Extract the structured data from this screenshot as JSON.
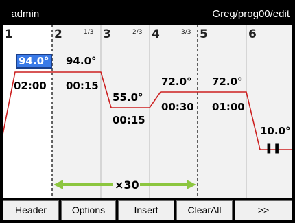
{
  "titlebar": {
    "user": "_admin",
    "path": "Greg/prog00/edit"
  },
  "steps": [
    {
      "num": "1",
      "temp": "94.0°",
      "time": "02:00"
    },
    {
      "num": "2",
      "sub": "1/3",
      "temp": "94.0°",
      "time": "00:15"
    },
    {
      "num": "3",
      "sub": "2/3",
      "temp": "55.0°",
      "time": "00:15"
    },
    {
      "num": "4",
      "sub": "3/3",
      "temp": "72.0°",
      "time": "00:30"
    },
    {
      "num": "5",
      "temp": "72.0°",
      "time": "01:00"
    },
    {
      "num": "6",
      "temp": "10.0°",
      "time": "❚❚"
    }
  ],
  "loop": {
    "label": "×30"
  },
  "buttons": [
    "Header",
    "Options",
    "Insert",
    "ClearAll",
    ">>"
  ],
  "colors": {
    "profile_line": "#cc1f1f",
    "loop_arrow": "#8cc63f",
    "selected": "#3a7ae8"
  }
}
